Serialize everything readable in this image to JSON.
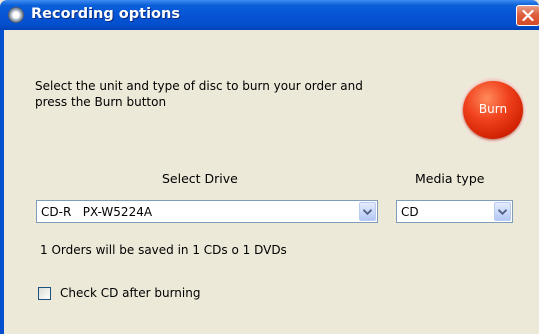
{
  "window": {
    "title": "Recording options",
    "title_icon": "cd-icon",
    "close_icon": "close-icon"
  },
  "instruction_text": "Select the unit and type of disc to burn your order and\npress the Burn button",
  "burn_button": {
    "label": "Burn",
    "color": "#e0301a"
  },
  "drive": {
    "label": "Select Drive",
    "selected": "CD-R   PX-W5224A",
    "dropdown_icon": "chevron-down-icon"
  },
  "media": {
    "label": "Media type",
    "selected": "CD",
    "dropdown_icon": "chevron-down-icon"
  },
  "orders_summary": "1 Orders will be saved in 1 CDs o 1 DVDs",
  "check_after_burning": {
    "label": "Check CD after burning",
    "checked": false
  },
  "colors": {
    "titlebar": "#0453d4",
    "dialog_background": "#ece9d8",
    "close_button": "#d44a25",
    "combo_border": "#7f9db9"
  }
}
